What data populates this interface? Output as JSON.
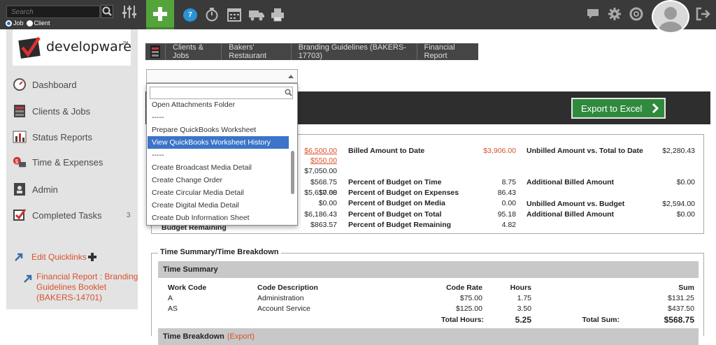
{
  "topbar": {
    "search_placeholder": "Search",
    "radio_job": "Job",
    "radio_client": "Client",
    "notification_count": "7"
  },
  "sidebar": {
    "logo_text": "developware",
    "logo_tm": "TM",
    "items": [
      {
        "label": "Dashboard",
        "icon": "speedometer-icon"
      },
      {
        "label": "Clients & Jobs",
        "icon": "cabinet-icon"
      },
      {
        "label": "Status Reports",
        "icon": "bar-chart-icon"
      },
      {
        "label": "Time & Expenses",
        "icon": "money-icon"
      },
      {
        "label": "Admin",
        "icon": "admin-icon"
      },
      {
        "label": "Completed Tasks",
        "icon": "checkbox-icon",
        "count": "3"
      }
    ],
    "edit_quicklinks": "Edit Quicklinks",
    "quicklinks": [
      {
        "line1": "Financial Report : Branding",
        "line2": "Guidelines Booklet",
        "line3": "(BAKERS-14701)"
      }
    ]
  },
  "breadcrumb": [
    "Clients & Jobs",
    "Bakers' Restaurant",
    "Branding Guidelines (BAKERS-17703)",
    "Financial Report"
  ],
  "dropdown": {
    "items": [
      "Open Attachments Folder",
      "-----",
      "Prepare QuickBooks Worksheet",
      "View QuickBooks Worksheet History",
      "-----",
      "Create Broadcast Media Detail",
      "Create Change Order",
      "Create Circular Media Detail",
      "Create Digital Media Detail",
      "Create Dub Information Sheet"
    ],
    "selected_index": 3
  },
  "export_label": "Export to Excel",
  "budget": {
    "col1_values": [
      "$6,500.00",
      "$550.00",
      "$7,050.00",
      "$568.75",
      "$0.00",
      "$5,617.68",
      "$0.00",
      "$6,186.43",
      "$863.57"
    ],
    "col1_last_label": "Budget Remaining",
    "col2": [
      {
        "label": "Billed Amount to Date",
        "value": "$3,906.00"
      },
      {
        "label": "Percent of Budget on Time",
        "value": "8.75"
      },
      {
        "label": "Percent of Budget on Expenses",
        "value": "86.43"
      },
      {
        "label": "Percent of Budget on Media",
        "value": "0.00"
      },
      {
        "label": "Percent of Budget on Total",
        "value": "95.18"
      },
      {
        "label": "Percent of Budget Remaining",
        "value": "4.82"
      }
    ],
    "col3": [
      {
        "label": "Unbilled Amount vs. Total to Date",
        "value": "$2,280.43"
      },
      {
        "label": "Additional Billed Amount",
        "value": "$0.00"
      },
      {
        "label": "Unbilled Amount vs. Budget",
        "value": "$2,594.00"
      },
      {
        "label": "Additional Billed Amount",
        "value": "$0.00"
      }
    ]
  },
  "time": {
    "legend": "Time Summary/Time Breakdown",
    "summary_title": "Time Summary",
    "columns": [
      "Work Code",
      "Code Description",
      "Code Rate",
      "Hours",
      "Sum"
    ],
    "rows": [
      {
        "code": "A",
        "desc": "Administration",
        "rate": "$75.00",
        "hours": "1.75",
        "sum": "$131.25"
      },
      {
        "code": "AS",
        "desc": "Account Service",
        "rate": "$125.00",
        "hours": "3.50",
        "sum": "$437.50"
      }
    ],
    "total_hours_label": "Total Hours:",
    "total_hours": "5.25",
    "total_sum_label": "Total Sum:",
    "total_sum": "$568.75",
    "breakdown_title": "Time Breakdown",
    "breakdown_link": "(Export)"
  },
  "colors": {
    "accent_green": "#55a43b",
    "link_orange": "#d9512c",
    "selection_blue": "#3b74c8"
  }
}
